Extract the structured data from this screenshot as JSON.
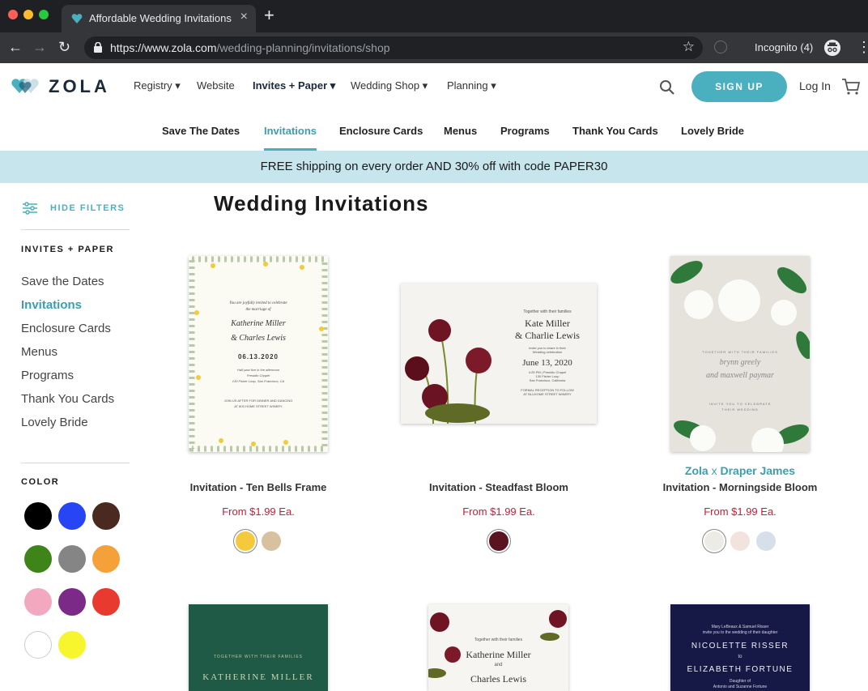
{
  "browser": {
    "tab_title": "Affordable Wedding Invitations",
    "url_host": "https://www.zola.com",
    "url_path": "/wedding-planning/invitations/shop",
    "incognito_label": "Incognito (4)"
  },
  "header": {
    "logo_text": "ZOLA",
    "nav": [
      "Registry",
      "Website",
      "Invites + Paper",
      "Wedding Shop",
      "Planning"
    ],
    "signup_label": "SIGN UP",
    "login_label": "Log In"
  },
  "subnav": [
    "Save The Dates",
    "Invitations",
    "Enclosure Cards",
    "Menus",
    "Programs",
    "Thank You Cards",
    "Lovely Bride"
  ],
  "promo": "FREE shipping on every order AND 30% off with code PAPER30",
  "sidebar": {
    "hide_filters": "HIDE FILTERS",
    "category_heading": "INVITES + PAPER",
    "categories": [
      "Save the Dates",
      "Invitations",
      "Enclosure Cards",
      "Menus",
      "Programs",
      "Thank You Cards",
      "Lovely Bride"
    ],
    "color_heading": "COLOR",
    "colors": [
      "#000000",
      "#2845f5",
      "#4a2a1e",
      "#3f8418",
      "#858585",
      "#f5a13a",
      "#f2a9bf",
      "#7b2a88",
      "#e83a2f",
      "#ffffff",
      "#f7f52e"
    ]
  },
  "main": {
    "title": "Wedding Invitations",
    "products": [
      {
        "name": "Invitation - Ten Bells Frame",
        "price": "From $1.99 Ea.",
        "options": [
          "#f5c93c",
          "#d8c19e"
        ],
        "card": {
          "l1": "You are joyfully invited to celebrate",
          "l2": "the marriage of",
          "name1": "Katherine Miller",
          "name2": "& Charles Lewis",
          "date": "06.13.2020",
          "l3": "Half past five in the afternoon",
          "l4": "Presidio Chapel",
          "l5": "130 Fisher Loop, San Francisco, CA",
          "l6": "JOIN US AFTER FOR DINNER AND DANCING",
          "l7": "AT 803 HOME STREET WINERY"
        }
      },
      {
        "name": "Invitation - Steadfast Bloom",
        "price": "From $1.99 Ea.",
        "options": [
          "#5a1420"
        ],
        "card": {
          "l1": "Together with their families",
          "name1": "Kate Miller",
          "name2": "& Charlie Lewis",
          "l2": "invite you to share in their",
          "l3": "Wedding celebration",
          "date": "June 13, 2020",
          "l4": "4:26 PM | Presidio Chapel",
          "l5": "130 Fisher Loop",
          "l6": "San Francisco, California",
          "l7": "FORMAL RECEPTION TO FOLLOW",
          "l8": "AT BLUXOME STREET WINERY"
        }
      },
      {
        "brand_a": "Zola",
        "brand_x": "x",
        "brand_b": "Draper James",
        "name": "Invitation - Morningside Bloom",
        "price": "From $1.99 Ea.",
        "options": [
          "#ecebe6",
          "#f3e3df",
          "#d6dfea"
        ],
        "card": {
          "l1": "TOGETHER WITH THEIR FAMILIES",
          "name1": "brynn greely",
          "name2": "and maxwell paymar",
          "l2": "INVITE YOU TO CELEBRATE",
          "l3": "THEIR WEDDING"
        }
      }
    ],
    "row2": [
      {
        "l1": "TOGETHER WITH THEIR FAMILIES",
        "name1": "KATHERINE MILLER"
      },
      {
        "l1": "Together with their families",
        "name1": "Katherine Miller",
        "and": "and",
        "name2": "Charles Lewis"
      },
      {
        "l1": "Mary LeBeaux & Samuel Risser",
        "l2": "invite you to the wedding of their daughter",
        "name1": "NICOLETTE RISSER",
        "to": "to",
        "name2": "ELIZABETH FORTUNE",
        "l3": "Daughter of",
        "l4": "Antonio and Suzanne Fortune"
      }
    ]
  }
}
